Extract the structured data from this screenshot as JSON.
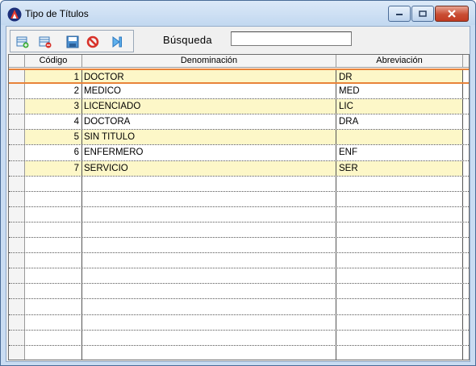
{
  "window": {
    "title": "Tipo de Títulos"
  },
  "toolbar": {
    "icons": [
      "add-record-icon",
      "delete-record-icon",
      "edit-record-icon",
      "cancel-icon",
      "last-record-icon"
    ]
  },
  "search": {
    "label": "Búsqueda",
    "value": ""
  },
  "grid": {
    "columns": [
      "Código",
      "Denominación",
      "Abreviación"
    ],
    "rows": [
      {
        "codigo": "1",
        "denominacion": "DOCTOR",
        "abreviacion": "DR"
      },
      {
        "codigo": "2",
        "denominacion": "MEDICO",
        "abreviacion": "MED"
      },
      {
        "codigo": "3",
        "denominacion": "LICENCIADO",
        "abreviacion": "LIC"
      },
      {
        "codigo": "4",
        "denominacion": "DOCTORA",
        "abreviacion": "DRA"
      },
      {
        "codigo": "5",
        "denominacion": "SIN TITULO",
        "abreviacion": ""
      },
      {
        "codigo": "6",
        "denominacion": "ENFERMERO",
        "abreviacion": "ENF"
      },
      {
        "codigo": "7",
        "denominacion": "SERVICIO",
        "abreviacion": "SER"
      }
    ],
    "selected_row": 0
  },
  "colors": {
    "row_highlight": "#fdf7c8",
    "selection_border": "#e8833a",
    "close_button": "#c94d33"
  }
}
